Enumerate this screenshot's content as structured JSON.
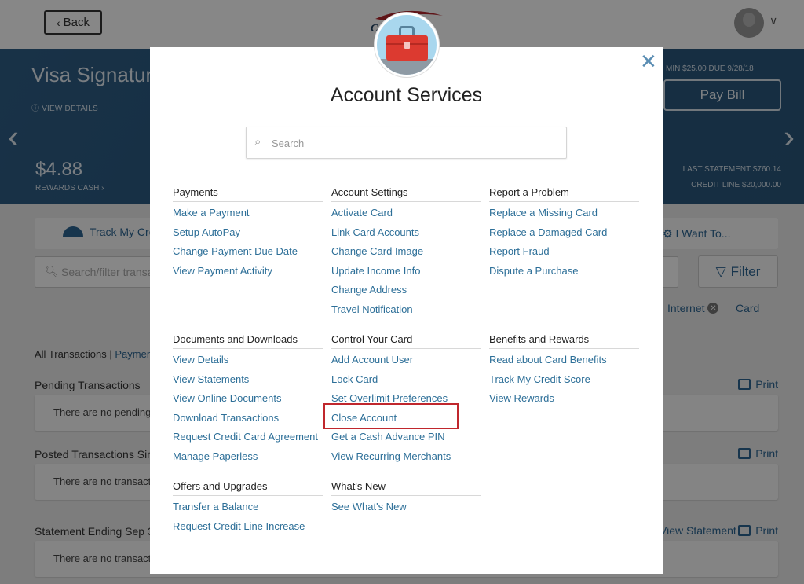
{
  "header": {
    "back_label": "Back",
    "logo_text": "Capital One",
    "user_menu_icon": "chevron-down-icon"
  },
  "hero": {
    "card_name": "Visa Signature",
    "view_details": "VIEW DETAILS",
    "rewards_amount": "$4.88",
    "rewards_label": "REWARDS CASH",
    "min_due": "MIN $25.00 DUE 9/28/18",
    "pay_bill": "Pay Bill",
    "last_statement": "LAST STATEMENT $760.14",
    "credit_line": "CREDIT LINE $20,000.00"
  },
  "tools": {
    "track_credit": "Track My Credit",
    "i_want_to": "I Want To...",
    "search_placeholder": "Search/filter transactions",
    "filter_label": "Filter",
    "chips": [
      "Internet",
      "Card"
    ]
  },
  "transactions": {
    "tabs_all": "All Transactions",
    "tabs_sep": " | ",
    "tabs_payments": "Payments",
    "sections": [
      {
        "title": "Pending Transactions",
        "empty": "There are no pending transactions",
        "print": "Print"
      },
      {
        "title": "Posted Transactions Since",
        "empty": "There are no transactions",
        "print": "Print"
      },
      {
        "title": "Statement Ending Sep 3",
        "empty": "There are no transactions",
        "print": "Print",
        "view_statement": "View Statement"
      }
    ]
  },
  "modal": {
    "title": "Account Services",
    "search_placeholder": "Search",
    "close_icon": "close-icon",
    "groups": [
      {
        "title": "Payments",
        "items": [
          "Make a Payment",
          "Setup AutoPay",
          "Change Payment Due Date",
          "View Payment Activity"
        ]
      },
      {
        "title": "Account Settings",
        "items": [
          "Activate Card",
          "Link Card Accounts",
          "Change Card Image",
          "Update Income Info",
          "Change Address",
          "Travel Notification"
        ]
      },
      {
        "title": "Report a Problem",
        "items": [
          "Replace a Missing Card",
          "Replace a Damaged Card",
          "Report Fraud",
          "Dispute a Purchase"
        ]
      },
      {
        "title": "Documents and Downloads",
        "items": [
          "View Details",
          "View Statements",
          "View Online Documents",
          "Download Transactions",
          "Request Credit Card Agreement",
          "Manage Paperless"
        ]
      },
      {
        "title": "Control Your Card",
        "items": [
          "Add Account User",
          "Lock Card",
          "Set Overlimit Preferences",
          "Close Account",
          "Get a Cash Advance PIN",
          "View Recurring Merchants"
        ]
      },
      {
        "title": "Benefits and Rewards",
        "items": [
          "Read about Card Benefits",
          "Track My Credit Score",
          "View Rewards"
        ]
      },
      {
        "title": "Offers and Upgrades",
        "items": [
          "Transfer a Balance",
          "Request Credit Line Increase"
        ]
      },
      {
        "title": "What's New",
        "items": [
          "See What's New"
        ]
      }
    ],
    "highlighted_item": "Close Account",
    "highlight_color": "#c0272d"
  },
  "colors": {
    "link": "#2d6f98",
    "hero_bg": "#2b5a80",
    "overlay": "rgba(0,0,0,0.47)"
  }
}
